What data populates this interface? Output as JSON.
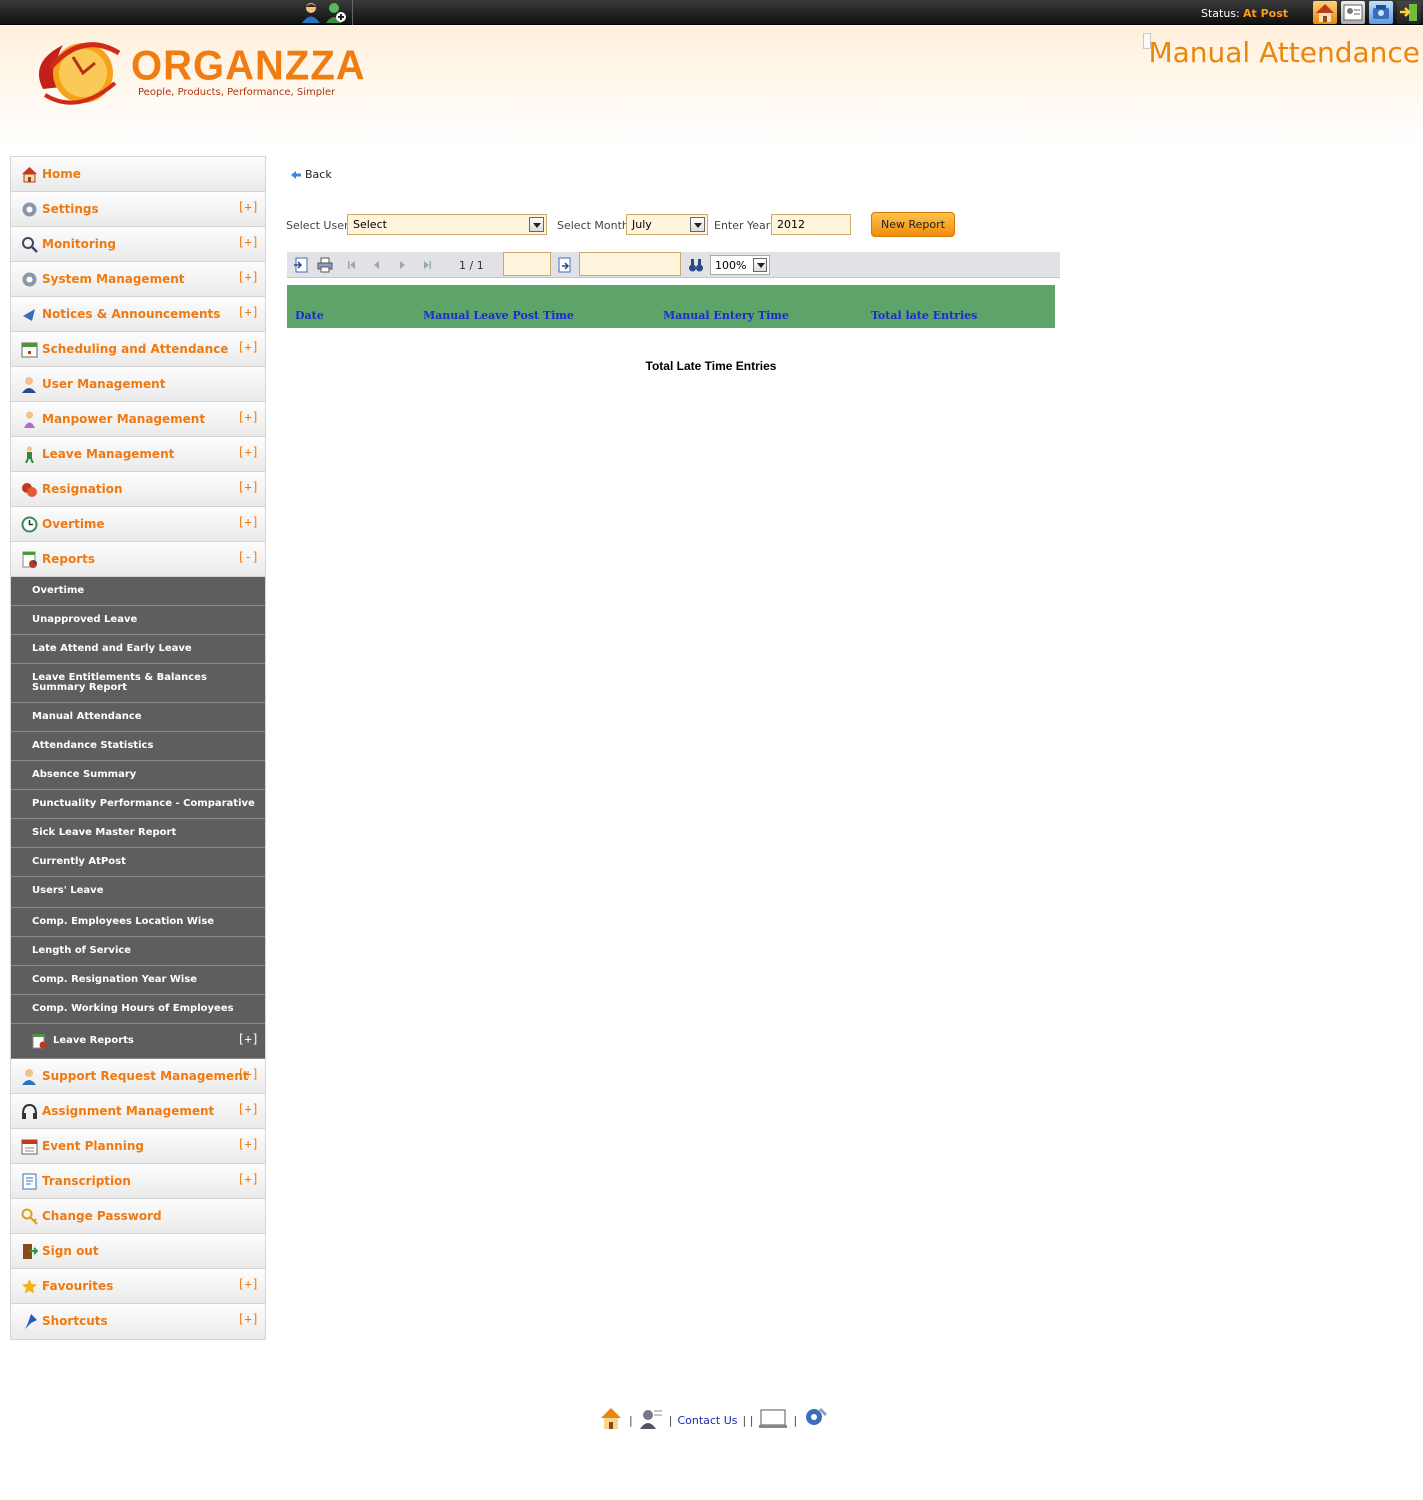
{
  "topbar": {
    "status_label": "Status:",
    "status_value": "At Post",
    "left_icons": [
      "user-icon",
      "add-user-icon"
    ],
    "right_icons": [
      "home-icon",
      "profile-icon",
      "phone-icon",
      "logout-icon"
    ]
  },
  "header": {
    "logo_name": "ORGANZZA",
    "logo_tagline": "People, Products, Performance, Simpler",
    "page_title": "Manual Attendance"
  },
  "sidebar": {
    "items": [
      {
        "label": "Home",
        "toggle": "",
        "icon": "home-icon"
      },
      {
        "label": "Settings",
        "toggle": "[+]",
        "icon": "gear-icon"
      },
      {
        "label": "Monitoring",
        "toggle": "[+]",
        "icon": "magnifier-icon"
      },
      {
        "label": "System Management",
        "toggle": "[+]",
        "icon": "gear-icon"
      },
      {
        "label": "Notices & Announcements",
        "toggle": "[+]",
        "icon": "megaphone-icon"
      },
      {
        "label": "Scheduling and Attendance",
        "toggle": "[+]",
        "icon": "calendar-icon"
      },
      {
        "label": "User Management",
        "toggle": "",
        "icon": "users-icon"
      },
      {
        "label": "Manpower Management",
        "toggle": "[+]",
        "icon": "person-icon"
      },
      {
        "label": "Leave Management",
        "toggle": "[+]",
        "icon": "walking-person-icon"
      },
      {
        "label": "Resignation",
        "toggle": "[+]",
        "icon": "resignation-icon"
      },
      {
        "label": "Overtime",
        "toggle": "[+]",
        "icon": "clock-icon"
      },
      {
        "label": "Reports",
        "toggle": "[-]",
        "icon": "report-icon"
      }
    ],
    "report_subitems": [
      "Overtime",
      "Unapproved Leave",
      "Late Attend and Early Leave",
      "Leave Entitlements & Balances Summary Report",
      "Manual Attendance",
      "Attendance Statistics",
      "Absence Summary",
      "Punctuality Performance - Comparative",
      "Sick Leave Master Report",
      "Currently AtPost",
      "Users' Leave",
      "Comp. Employees Location Wise",
      "Length of Service",
      "Comp. Resignation Year Wise",
      "Comp. Working Hours of Employees"
    ],
    "leave_reports": {
      "label": "Leave Reports",
      "toggle": "[+]",
      "icon": "report-icon"
    },
    "items_after": [
      {
        "label": "Support Request Management",
        "toggle": "[+]",
        "icon": "support-icon"
      },
      {
        "label": "Assignment Management",
        "toggle": "[+]",
        "icon": "headset-icon"
      },
      {
        "label": "Event Planning",
        "toggle": "[+]",
        "icon": "calendar-icon"
      },
      {
        "label": "Transcription",
        "toggle": "[+]",
        "icon": "document-icon"
      },
      {
        "label": "Change Password",
        "toggle": "",
        "icon": "key-icon"
      },
      {
        "label": "Sign out",
        "toggle": "",
        "icon": "door-icon"
      },
      {
        "label": "Favourites",
        "toggle": "[+]",
        "icon": "star-icon"
      },
      {
        "label": "Shortcuts",
        "toggle": "[+]",
        "icon": "pin-icon"
      }
    ]
  },
  "main": {
    "back_label": "Back",
    "select_user_label": "Select User",
    "select_user_value": "Select",
    "select_month_label": "Select Month",
    "select_month_value": "July",
    "enter_year_label": "Enter Year",
    "year_value": "2012",
    "new_report_label": "New Report",
    "toolbar": {
      "page_info": "1 / 1",
      "zoom": "100%"
    },
    "table_headers": [
      "Date",
      "Manual Leave Post Time",
      "Manual Entery Time",
      "Total late Entries"
    ],
    "total_late_label": "Total Late Time Entries"
  },
  "footer": {
    "contact_label": "Contact Us",
    "icons": [
      "home-icon",
      "profile-icon",
      "help-icon",
      "settings-icon"
    ]
  },
  "colors": {
    "accent": "#f07a10",
    "table_header_bg": "#5da36a",
    "table_header_text": "#1a2bd6",
    "submenu_bg": "#5e5e5e"
  }
}
